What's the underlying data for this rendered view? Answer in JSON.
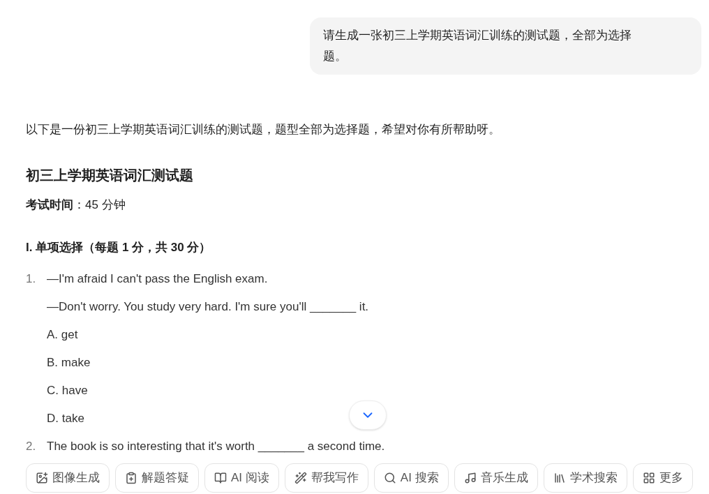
{
  "user_message": "请生成一张初三上学期英语词汇训练的测试题，全部为选择题。",
  "reply": {
    "intro": "以下是一份初三上学期英语词汇训练的测试题，题型全部为选择题，希望对你有所帮助呀。",
    "title": "初三上学期英语词汇测试题",
    "exam_time": {
      "label": "考试时间",
      "value": "：45 分钟"
    },
    "section_heading": "I. 单项选择（每题 1 分，共 30 分）",
    "questions": [
      {
        "number": "1.",
        "lines": [
          "—I'm afraid I can't pass the English exam.",
          "—Don't worry. You study very hard. I'm sure you'll _______ it.",
          "A. get",
          "B. make",
          "C. have",
          "D. take"
        ]
      },
      {
        "number": "2.",
        "lines": [
          "The book is so interesting that it's worth _______ a second time."
        ]
      }
    ]
  },
  "tools": [
    {
      "kind": "image",
      "label": "图像生成"
    },
    {
      "kind": "solve",
      "label": "解题答疑"
    },
    {
      "kind": "read",
      "label": "AI 阅读"
    },
    {
      "kind": "write",
      "label": "帮我写作"
    },
    {
      "kind": "search",
      "label": "AI 搜索"
    },
    {
      "kind": "music",
      "label": "音乐生成"
    },
    {
      "kind": "academic",
      "label": "学术搜索"
    },
    {
      "kind": "more",
      "label": "更多"
    }
  ]
}
